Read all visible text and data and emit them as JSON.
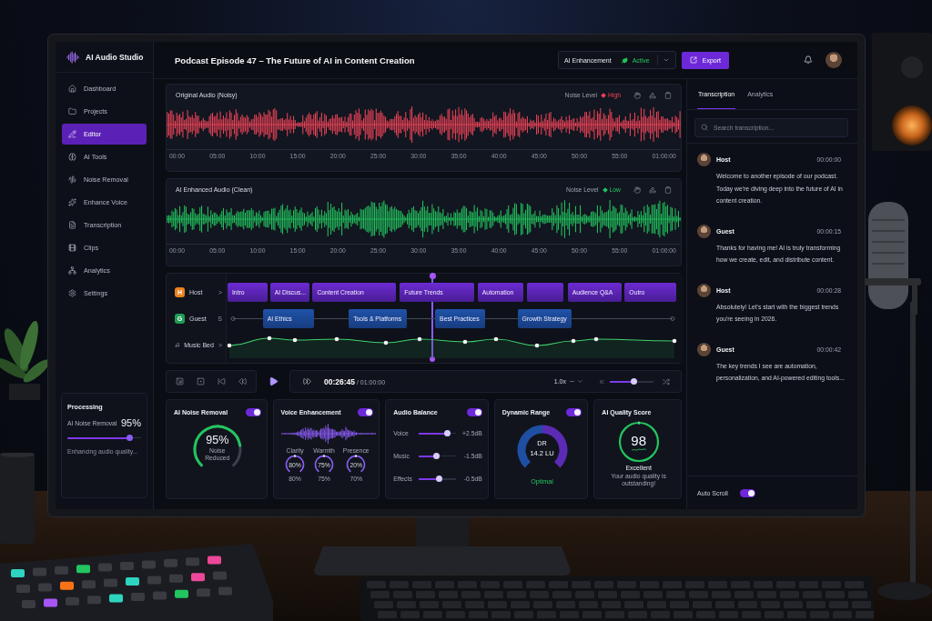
{
  "app": {
    "name": "AI Audio Studio"
  },
  "sidebar": {
    "items": [
      {
        "label": "Dashboard",
        "selected": false
      },
      {
        "label": "Projects",
        "selected": false
      },
      {
        "label": "Editor",
        "selected": true
      },
      {
        "label": "AI Tools",
        "selected": false
      },
      {
        "label": "Noise Removal",
        "selected": false
      },
      {
        "label": "Enhance Voice",
        "selected": false
      },
      {
        "label": "Transcription",
        "selected": false
      },
      {
        "label": "Clips",
        "selected": false
      },
      {
        "label": "Analytics",
        "selected": false
      },
      {
        "label": "Settings",
        "selected": false
      }
    ],
    "processing": {
      "title": "Processing",
      "task": "AI Noise Removal",
      "value": "95%",
      "level": 0.85,
      "status": "Enhancing audio quality..."
    }
  },
  "header": {
    "title": "Podcast Episode 47 – The Future of AI in Content Creation",
    "enhancement": {
      "label": "AI Enhancement",
      "status": "Active",
      "on": true
    },
    "export_button": "Export"
  },
  "waveforms": [
    {
      "title": "Original Audio (Noisy)",
      "noise_label": "Noise Level",
      "noise_value": "High",
      "color": "#ef4458",
      "ticks": [
        "00:00",
        "05:00",
        "10:00",
        "15:00",
        "20:00",
        "25:00",
        "30:00",
        "35:00",
        "40:00",
        "45:00",
        "50:00",
        "55:00",
        "01:00:00"
      ]
    },
    {
      "title": "AI Enhanced Audio (Clean)",
      "noise_label": "Noise Level",
      "noise_value": "Low",
      "color": "#22c55e",
      "ticks": [
        "00:00",
        "05:00",
        "10:00",
        "15:00",
        "20:00",
        "25:00",
        "30:00",
        "35:00",
        "40:00",
        "45:00",
        "50:00",
        "55:00",
        "01:00:00"
      ]
    }
  ],
  "timeline": {
    "tracks": [
      {
        "name": "Host",
        "badge": "H",
        "color": "#e8821e",
        "toggle": ">",
        "kind": "clips",
        "clips": [
          {
            "label": "Intro"
          },
          {
            "label": "AI Discus..."
          },
          {
            "label": "Content Creation"
          },
          {
            "label": "Future Trends"
          },
          {
            "label": "Automation"
          },
          {
            "label": "Audience Q&A"
          },
          {
            "label": "Outro"
          }
        ]
      },
      {
        "name": "Guest",
        "badge": "G",
        "color": "#1f9d55",
        "toggle": "S",
        "kind": "segments",
        "clips": [
          {
            "label": "AI Ethics"
          },
          {
            "label": "Tools & Platforms"
          },
          {
            "label": "Best Practices"
          },
          {
            "label": "Growth Strategy"
          }
        ]
      },
      {
        "name": "Music Bed",
        "toggle": ">",
        "kind": "envelope"
      }
    ],
    "playhead": {
      "level": 0.455
    }
  },
  "transport": {
    "time": "**00:26:45** / 01:00:00",
    "speed": "1.0x",
    "zoom": {
      "level": 0.55
    }
  },
  "cards": [
    {
      "kind": "gauge",
      "title": "AI Noise Removal",
      "on": true,
      "value": "95%",
      "caption": "Noise Reduced",
      "level": 0.8
    },
    {
      "kind": "voice",
      "title": "Voice Enhancement",
      "on": true,
      "knobs": [
        {
          "label": "Clarity",
          "value": "80%",
          "reading": "80%"
        },
        {
          "label": "Warmth",
          "value": "75%",
          "reading": "75%"
        },
        {
          "label": "Presence",
          "value": "20%",
          "reading": "70%"
        }
      ]
    },
    {
      "kind": "balance",
      "title": "Audio Balance",
      "on": true,
      "channels": [
        {
          "name": "Voice",
          "level": 0.77,
          "reading": "+2.5dB"
        },
        {
          "name": "Music",
          "level": 0.48,
          "reading": "-1.5dB"
        },
        {
          "name": "Effects",
          "level": 0.56,
          "reading": "-0.5dB"
        }
      ]
    },
    {
      "kind": "range",
      "title": "Dynamic Range",
      "on": true,
      "label": "DR",
      "value": "14.2 LU",
      "status": "Optimal"
    },
    {
      "kind": "score",
      "title": "AI Quality Score",
      "value": "98",
      "rating": "Excellent",
      "note": "Your audio quality is outstanding!"
    }
  ],
  "transcript": {
    "tabs": [
      {
        "label": "Transcription",
        "selected": true
      },
      {
        "label": "Analytics",
        "selected": false
      }
    ],
    "search": {
      "placeholder": "Search transcription..."
    },
    "entries": [
      {
        "speaker": "Host",
        "time": "00:00:00",
        "text": "Welcome to another episode of our podcast. Today we're diving deep into the future of AI in content creation."
      },
      {
        "speaker": "Guest",
        "time": "00:00:15",
        "text": "Thanks for having me! AI is truly transforming how we create, edit, and distribute content."
      },
      {
        "speaker": "Host",
        "time": "00:00:28",
        "text": "Absolutely! Let's start with the biggest trends you're seeing in 2026."
      },
      {
        "speaker": "Guest",
        "time": "00:00:42",
        "text": "The key trends I see are automation, personalization, and AI-powered editing tools..."
      }
    ],
    "auto_scroll": {
      "label": "Auto Scroll",
      "on": true
    }
  }
}
